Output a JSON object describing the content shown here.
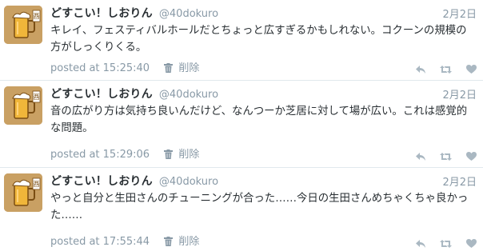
{
  "colors": {
    "text": "#292f33",
    "muted": "#8899a6",
    "divider": "#e1e8ed",
    "avatar_bg": "#c9a063"
  },
  "tweets": [
    {
      "name": "どすこい！しおりん",
      "handle": "@40dokuro",
      "date": "2月2日",
      "text": "キレイ、フェスティバルホールだとちょっと広すぎるかもしれない。コクーンの規模の方がしっくりくる。",
      "posted": "posted at 15:25:40",
      "delete_label": "削除"
    },
    {
      "name": "どすこい！しおりん",
      "handle": "@40dokuro",
      "date": "2月2日",
      "text": "音の広がり方は気持ち良いんだけど、なんつーか芝居に対して場が広い。これは感覚的な問題。",
      "posted": "posted at 15:29:06",
      "delete_label": "削除"
    },
    {
      "name": "どすこい！しおりん",
      "handle": "@40dokuro",
      "date": "2月2日",
      "text": "やっと自分と生田さんのチューニングが合った……今日の生田さんめちゃくちゃ良かった……",
      "posted": "posted at 17:55:44",
      "delete_label": "削除"
    }
  ],
  "icons": {
    "avatar": "beer-mug-avatar",
    "trash": "trash-icon",
    "reply": "reply-icon",
    "retweet": "retweet-icon",
    "like": "heart-icon"
  }
}
